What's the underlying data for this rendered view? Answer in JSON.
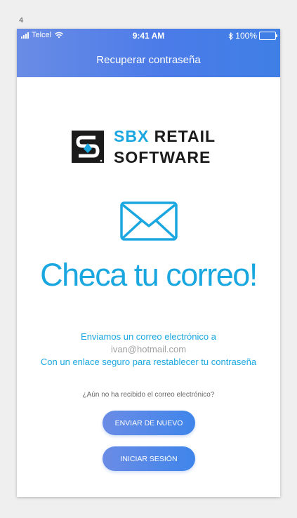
{
  "artboard": {
    "label": "4"
  },
  "status_bar": {
    "carrier": "Telcel",
    "time": "9:41 AM",
    "battery": "100%",
    "icons": [
      "signal-icon",
      "wifi-icon",
      "bluetooth-icon",
      "battery-icon"
    ]
  },
  "header": {
    "title": "Recuperar contraseña"
  },
  "logo": {
    "line1_accent": "SBX",
    "line1_rest": " RETAIL",
    "line2": "SOFTWARE"
  },
  "main": {
    "icon": "mail-icon",
    "headline": "Checa tu correo!",
    "info_line1": "Enviamos un correo electrónico a",
    "email": "ivan@hotmail.com",
    "info_line3": "Con un enlace seguro para restablecer tu contraseña",
    "question": "¿Aún no ha recibido el correo electrónico?",
    "resend_label": "ENVIAR DE NUEVO",
    "login_label": "INICIAR SESIÓN"
  },
  "colors": {
    "accent": "#1aa7e0",
    "header_gradient_start": "#6a8ce6",
    "header_gradient_end": "#3f7fe6",
    "logo_dark": "#1b1b1b"
  }
}
